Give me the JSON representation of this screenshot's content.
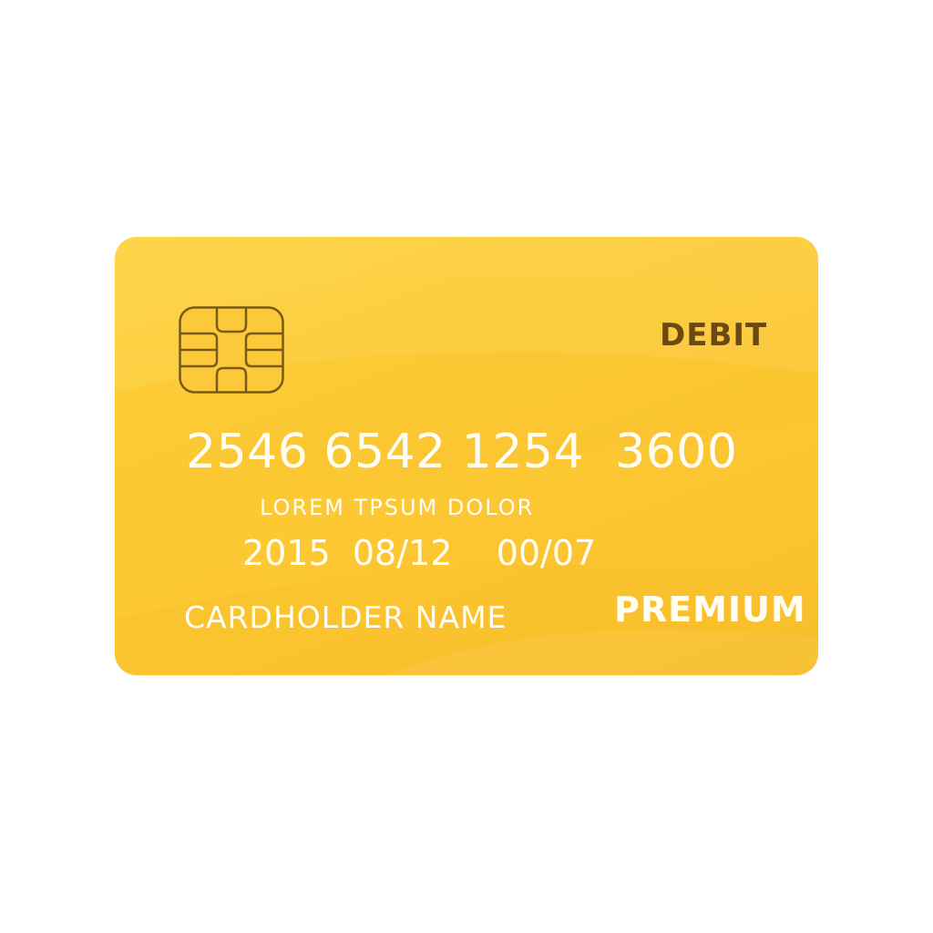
{
  "card": {
    "type_label": "DEBIT",
    "number": "2546 6542 1254  3600",
    "tagline": "LOREM TPSUM DOLOR",
    "dates": "2015  08/12    00/07",
    "holder_name": "CARDHOLDER NAME",
    "tier": "PREMIUM"
  },
  "colors": {
    "card_base": "#fcc935",
    "chip_stroke": "#7a5a14",
    "type_label": "#6b4a12",
    "card_text": "#fffdf4"
  },
  "icons": {
    "chip": "emv-chip-icon"
  }
}
